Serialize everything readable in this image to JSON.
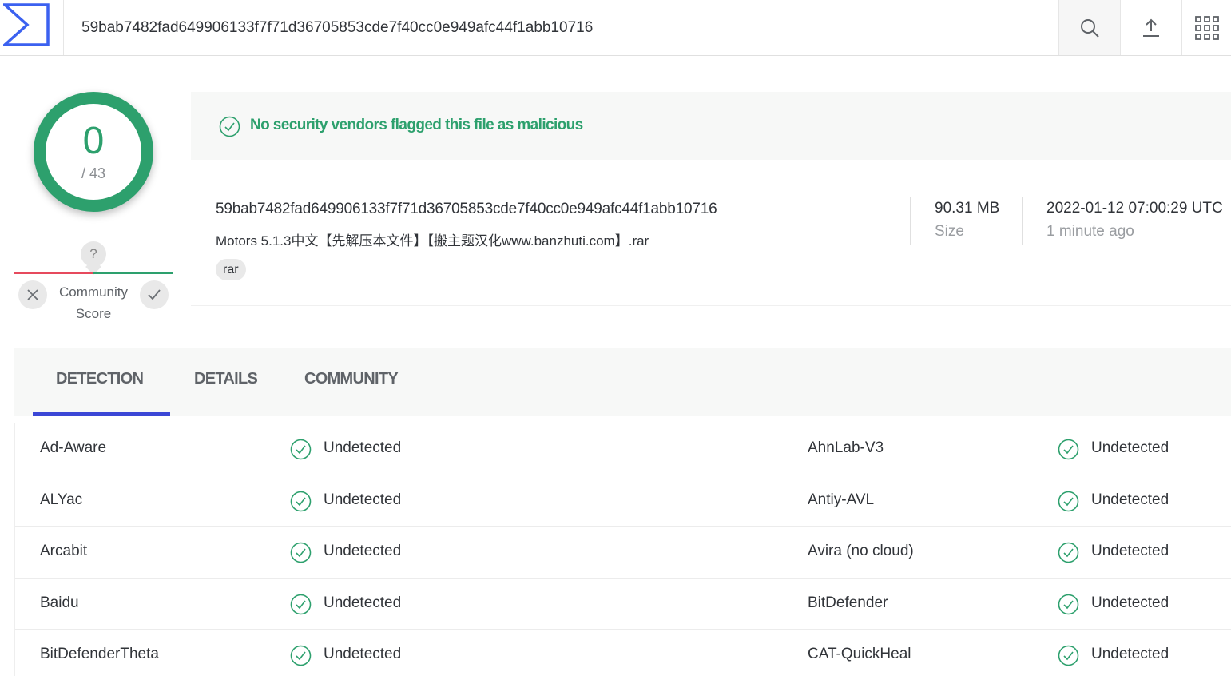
{
  "header": {
    "search_value": "59bab7482fad649906133f7f71d36705853cde7f40cc0e949afc44f1abb10716",
    "icons": {
      "logo": "virustotal-logo-icon",
      "search": "search-icon",
      "upload": "upload-icon",
      "apps": "apps-grid-icon"
    }
  },
  "score": {
    "detections": "0",
    "total": "/ 43",
    "community_label_line1": "Community",
    "community_label_line2": "Score",
    "unknown": "?"
  },
  "banner": {
    "message": "No security vendors flagged this file as malicious"
  },
  "file": {
    "hash": "59bab7482fad649906133f7f71d36705853cde7f40cc0e949afc44f1abb10716",
    "name": "Motors 5.1.3中文【先解压本文件】【搬主题汉化www.banzhuti.com】.rar",
    "tag": "rar",
    "size": "90.31 MB",
    "size_label": "Size",
    "date": "2022-01-12 07:00:29 UTC",
    "date_relative": "1 minute ago"
  },
  "tabs": [
    "DETECTION",
    "DETAILS",
    "COMMUNITY"
  ],
  "detections": [
    {
      "left_vendor": "Ad-Aware",
      "left_result": "Undetected",
      "right_vendor": "AhnLab-V3",
      "right_result": "Undetected"
    },
    {
      "left_vendor": "ALYac",
      "left_result": "Undetected",
      "right_vendor": "Antiy-AVL",
      "right_result": "Undetected"
    },
    {
      "left_vendor": "Arcabit",
      "left_result": "Undetected",
      "right_vendor": "Avira (no cloud)",
      "right_result": "Undetected"
    },
    {
      "left_vendor": "Baidu",
      "left_result": "Undetected",
      "right_vendor": "BitDefender",
      "right_result": "Undetected"
    },
    {
      "left_vendor": "BitDefenderTheta",
      "left_result": "Undetected",
      "right_vendor": "CAT-QuickHeal",
      "right_result": "Undetected"
    }
  ],
  "colors": {
    "clean_green": "#2da06d",
    "accent_blue": "#3b47d6",
    "negative_red": "#e64a5d"
  }
}
